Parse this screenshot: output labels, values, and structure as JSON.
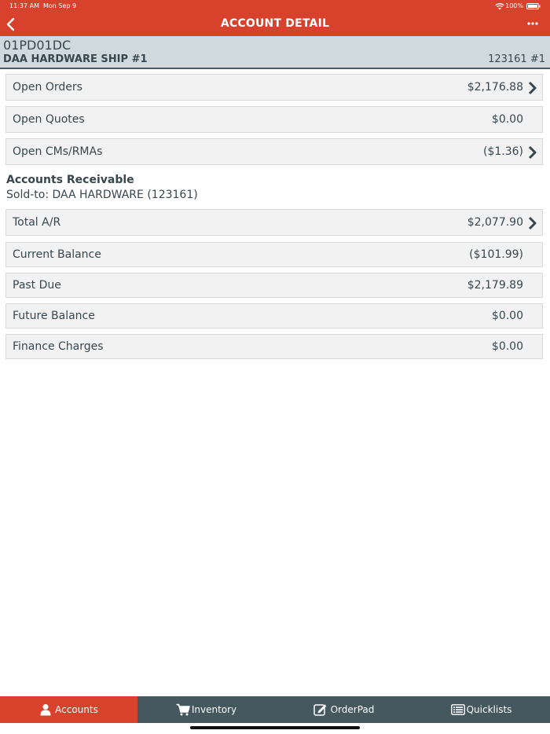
{
  "status_bar": {
    "time": "11:37 AM",
    "date": "Mon Sep 9",
    "battery": "100%"
  },
  "nav": {
    "title": "ACCOUNT DETAIL"
  },
  "account": {
    "code": "01PD01DC",
    "name": "DAA HARDWARE SHIP #1",
    "number": "123161 #1"
  },
  "summary_rows": [
    {
      "label": "Open Orders",
      "value": "$2,176.88",
      "has_chevron": true
    },
    {
      "label": "Open Quotes",
      "value": "$0.00",
      "has_chevron": false
    },
    {
      "label": "Open CMs/RMAs",
      "value": "($1.36)",
      "has_chevron": true
    }
  ],
  "ar_section": {
    "title": "Accounts Receivable",
    "subtitle": "Sold-to: DAA HARDWARE (123161)"
  },
  "ar_rows": [
    {
      "label": "Total A/R",
      "value": "$2,077.90",
      "has_chevron": true
    },
    {
      "label": "Current Balance",
      "value": "($101.99)",
      "has_chevron": false
    },
    {
      "label": "Past Due",
      "value": "$2,179.89",
      "has_chevron": false
    },
    {
      "label": "Future Balance",
      "value": "$0.00",
      "has_chevron": false
    },
    {
      "label": "Finance Charges",
      "value": "$0.00",
      "has_chevron": false
    }
  ],
  "tabs": [
    {
      "label": "Accounts",
      "icon": "person-icon",
      "active": true
    },
    {
      "label": "Inventory",
      "icon": "cart-icon",
      "active": false
    },
    {
      "label": "OrderPad",
      "icon": "edit-icon",
      "active": false
    },
    {
      "label": "Quicklists",
      "icon": "list-icon",
      "active": false
    }
  ],
  "colors": {
    "brand_red": "#d8412b",
    "header_bg": "#cfd9de",
    "tabbar_bg": "#45575f"
  }
}
